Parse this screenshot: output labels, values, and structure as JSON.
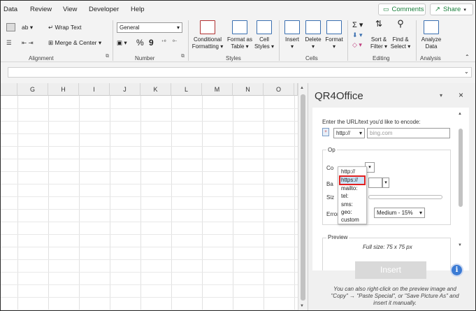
{
  "menu": {
    "items": [
      "Data",
      "Review",
      "View",
      "Developer",
      "Help"
    ],
    "comments": "Comments",
    "share": "Share"
  },
  "ribbon": {
    "alignment": {
      "label": "Alignment",
      "wrap_text": "Wrap Text",
      "merge_center": "Merge & Center"
    },
    "number": {
      "label": "Number",
      "format": "General",
      "percent": "%",
      "comma": "9"
    },
    "styles": {
      "label": "Styles",
      "conditional": [
        "Conditional",
        "Formatting"
      ],
      "format_table": [
        "Format as",
        "Table"
      ],
      "cell_styles": [
        "Cell",
        "Styles"
      ]
    },
    "cells": {
      "label": "Cells",
      "insert": "Insert",
      "delete": "Delete",
      "format": "Format"
    },
    "editing": {
      "label": "Editing",
      "sort_filter": [
        "Sort &",
        "Filter"
      ],
      "find_select": [
        "Find &",
        "Select"
      ]
    },
    "analysis": {
      "label": "Analysis",
      "analyze": [
        "Analyze",
        "Data"
      ]
    }
  },
  "sheet": {
    "columns": [
      "G",
      "H",
      "I",
      "J",
      "K",
      "L",
      "M",
      "N",
      "O"
    ]
  },
  "pane": {
    "title": "QR4Office",
    "prompt": "Enter the URL/text you'd like to encode:",
    "protocol_selected": "http://",
    "url_placeholder": "bing.com",
    "protocol_options": [
      "http://",
      "https://",
      "mailto:",
      "tel:",
      "sms:",
      "geo:",
      "custom"
    ],
    "highlighted_option": "https://",
    "options_legend": "Op",
    "color_label": "Co",
    "background_label": "Ba",
    "size_label": "Siz",
    "error_label": "Error correction:",
    "error_value": "Medium - 15%",
    "preview_legend": "Preview",
    "preview_size": "Full size: 75 x 75 px",
    "insert_button": "Insert",
    "info_symbol": "i",
    "footnote": "You can also right-click on the preview image and \"Copy\" → \"Paste Special\", or \"Save Picture As\" and insert it manually."
  },
  "colors": {
    "highlight_border": "#e02020",
    "selection_fill": "#cce4f7",
    "info_blue": "#3b7bd4"
  }
}
